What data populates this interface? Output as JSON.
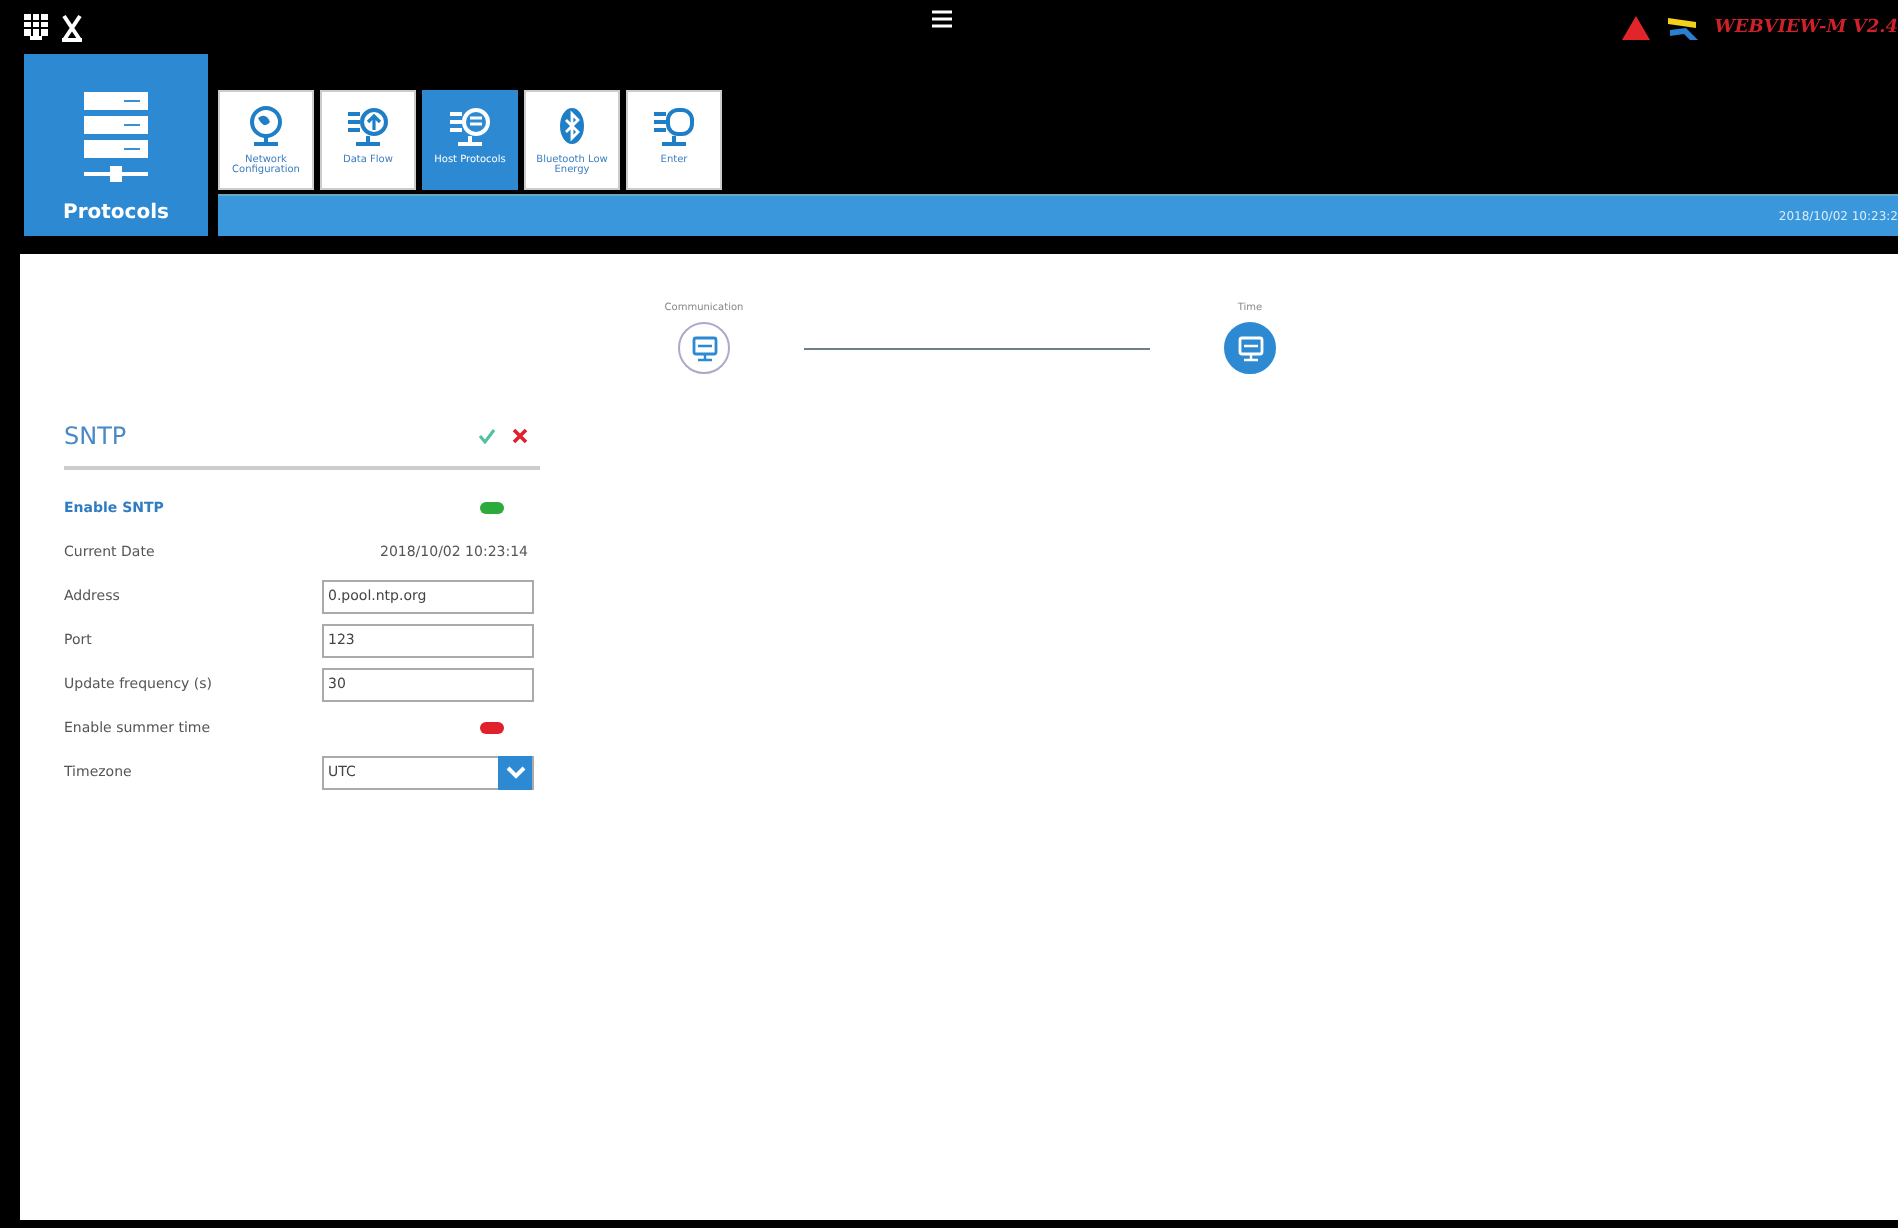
{
  "header": {
    "brand": "WEBVIEW-M V2.4",
    "section": "Protocols",
    "timestamp": "2018/10/02 10:23:2"
  },
  "tabs": [
    {
      "label": "Network Configuration",
      "selected": false
    },
    {
      "label": "Data Flow",
      "selected": false
    },
    {
      "label": "Host Protocols",
      "selected": true
    },
    {
      "label": "Bluetooth Low Energy",
      "selected": false
    },
    {
      "label": "Enter",
      "selected": false
    }
  ],
  "steps": [
    {
      "label": "Communication",
      "selected": false
    },
    {
      "label": "Time",
      "selected": true
    }
  ],
  "panel": {
    "title": "SNTP",
    "rows": [
      {
        "kind": "toggle",
        "label": "Enable SNTP",
        "emphasis": true,
        "on": true
      },
      {
        "kind": "text",
        "label": "Current Date",
        "emphasis": false,
        "value": "2018/10/02 10:23:14"
      },
      {
        "kind": "input",
        "label": "Address",
        "emphasis": false,
        "value": "0.pool.ntp.org"
      },
      {
        "kind": "input",
        "label": "Port",
        "emphasis": false,
        "value": "123"
      },
      {
        "kind": "input",
        "label": "Update frequency (s)",
        "emphasis": false,
        "value": "30"
      },
      {
        "kind": "toggle",
        "label": "Enable summer time",
        "emphasis": false,
        "on": false
      },
      {
        "kind": "select",
        "label": "Timezone",
        "emphasis": false,
        "value": "UTC"
      }
    ]
  }
}
